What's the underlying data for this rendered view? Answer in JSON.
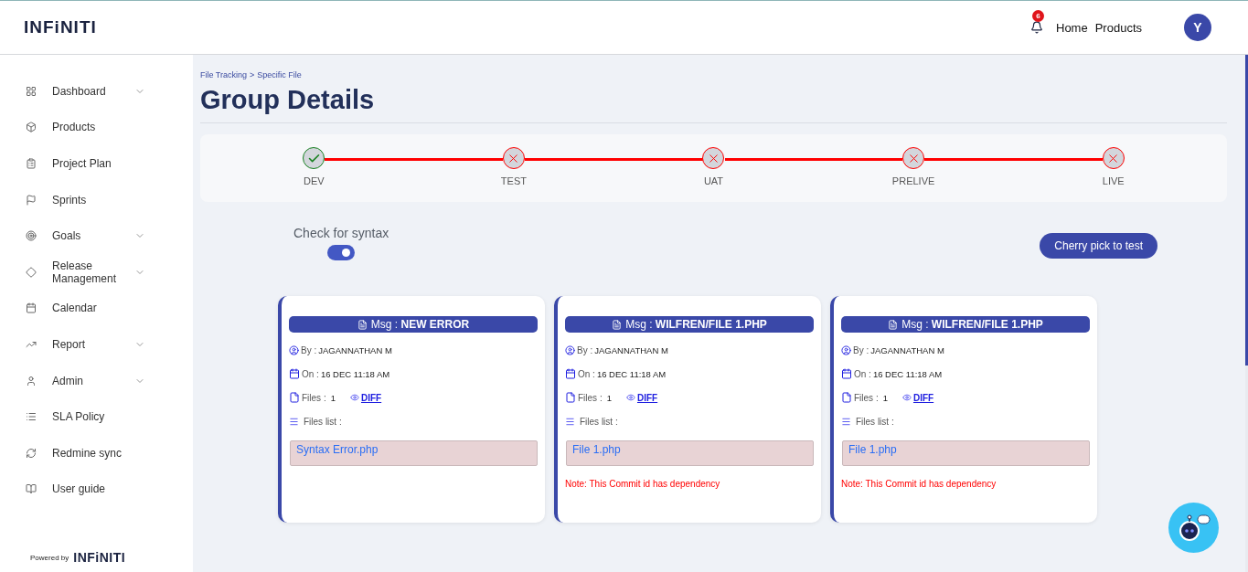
{
  "header": {
    "logo": "INFiNITI",
    "notifications": {
      "count": "6"
    },
    "nav": [
      "Home",
      "Products"
    ],
    "avatar": "Y"
  },
  "sidebar": {
    "items": [
      {
        "label": "Dashboard",
        "expandable": true
      },
      {
        "label": "Products",
        "expandable": false
      },
      {
        "label": "Project Plan",
        "expandable": false
      },
      {
        "label": "Sprints",
        "expandable": false
      },
      {
        "label": "Goals",
        "expandable": true
      },
      {
        "label": "Release Management",
        "expandable": true
      },
      {
        "label": "Calendar",
        "expandable": false
      },
      {
        "label": "Report",
        "expandable": true
      },
      {
        "label": "Admin",
        "expandable": true
      },
      {
        "label": "SLA Policy",
        "expandable": false
      },
      {
        "label": "Redmine sync",
        "expandable": false
      },
      {
        "label": "User guide",
        "expandable": false
      }
    ],
    "powered_by": "Powered by",
    "powered_logo": "INFiNITI"
  },
  "breadcrumb": [
    "File Tracking",
    ">",
    "Specific File"
  ],
  "title": "Group Details",
  "stages": [
    {
      "label": "DEV",
      "passed": true
    },
    {
      "label": "TEST",
      "passed": false
    },
    {
      "label": "UAT",
      "passed": false
    },
    {
      "label": "PRELIVE",
      "passed": false
    },
    {
      "label": "LIVE",
      "passed": false
    }
  ],
  "syntax_check": {
    "label": "Check for syntax",
    "on": true
  },
  "cherry_pick_button": "Cherry pick to test",
  "commits": [
    {
      "msg_label": "Msg :",
      "msg": "NEW ERROR",
      "by_label": "By :",
      "by": "JAGANNATHAN M",
      "on_label": "On :",
      "on": "16 DEC 11:18 AM",
      "files_label": "Files :",
      "files": "1",
      "diff": "DIFF",
      "files_list_label": "Files list :",
      "file_names": [
        "Syntax Error.php"
      ]
    },
    {
      "msg_label": "Msg :",
      "msg": "WILFREN/FILE 1.PHP",
      "by_label": "By :",
      "by": "JAGANNATHAN M",
      "on_label": "On :",
      "on": "16 DEC 11:18 AM",
      "files_label": "Files :",
      "files": "1",
      "diff": "DIFF",
      "files_list_label": "Files list :",
      "file_names": [
        "File 1.php"
      ],
      "note": "Note: This Commit id has dependency"
    },
    {
      "msg_label": "Msg :",
      "msg": "WILFREN/FILE 1.PHP",
      "by_label": "By :",
      "by": "JAGANNATHAN M",
      "on_label": "On :",
      "on": "16 DEC 11:18 AM",
      "files_label": "Files :",
      "files": "1",
      "diff": "DIFF",
      "files_list_label": "Files list :",
      "file_names": [
        "File 1.php"
      ],
      "note": "Note: This Commit id has dependency"
    }
  ]
}
